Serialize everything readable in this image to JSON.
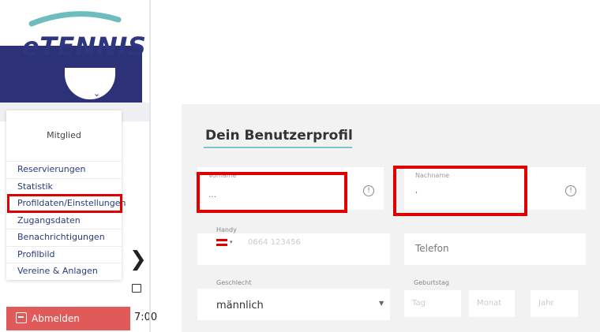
{
  "sidebar": {
    "logo": "eTENNIS",
    "menu_header": "Mitglied",
    "items": [
      {
        "label": "Reservierungen"
      },
      {
        "label": "Statistik"
      },
      {
        "label": "Profildaten/Einstellungen"
      },
      {
        "label": "Zugangsdaten"
      },
      {
        "label": "Benachrichtigungen"
      },
      {
        "label": "Profilbild"
      },
      {
        "label": "Vereine & Anlagen"
      }
    ],
    "logout_label": "Abmelden",
    "time_fragment": "7:00"
  },
  "profile": {
    "title": "Dein Benutzerprofil",
    "vorname": {
      "label": "Vorname",
      "value": "…"
    },
    "nachname": {
      "label": "Nachname",
      "value": "ʻ"
    },
    "handy": {
      "label": "Handy",
      "placeholder": "0664 123456"
    },
    "telefon": {
      "placeholder": "Telefon"
    },
    "geschlecht": {
      "label": "Geschlecht",
      "value": "männlich"
    },
    "geburtstag": {
      "label": "Geburtstag",
      "tag": "Tag",
      "monat": "Monat",
      "jahr": "Jahr"
    }
  },
  "colors": {
    "brand_navy": "#2d3278",
    "highlight_red": "#e00000",
    "logout_red": "#e05a5a",
    "title_underline": "#7ec3c7"
  }
}
